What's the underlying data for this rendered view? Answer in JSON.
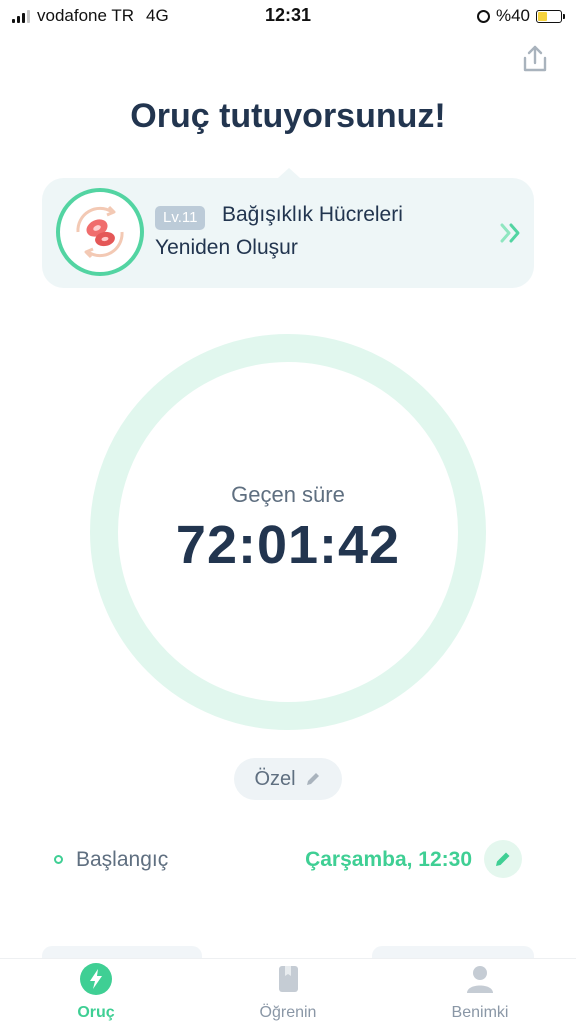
{
  "status_bar": {
    "carrier": "vodafone TR",
    "network": "4G",
    "time": "12:31",
    "battery": "%40",
    "battery_level": 0.4
  },
  "header": {
    "title": "Oruç tutuyorsunuz!",
    "share_icon": "share-icon"
  },
  "level_card": {
    "badge": "Lv.11",
    "title_line1": "Bağışıklık Hücreleri",
    "title_line2": "Yeniden Oluşur",
    "icon": "immune-cell-icon",
    "accent": "#53d4a2"
  },
  "timer": {
    "label": "Geçen süre",
    "elapsed": "72:01:42",
    "ring_color": "#e1f7ee",
    "progress": 0
  },
  "plan": {
    "label": "Özel"
  },
  "start": {
    "label": "Başlangıç",
    "value": "Çarşamba, 12:30"
  },
  "tabs": [
    {
      "label": "Oruç",
      "icon": "lightning-icon",
      "active": true
    },
    {
      "label": "Öğrenin",
      "icon": "book-icon",
      "active": false
    },
    {
      "label": "Benimki",
      "icon": "profile-icon",
      "active": false
    }
  ],
  "colors": {
    "primary_text": "#22354f",
    "accent_green": "#3fcf94",
    "muted_text": "#5f6f80",
    "card_bg": "#eef6f7"
  }
}
